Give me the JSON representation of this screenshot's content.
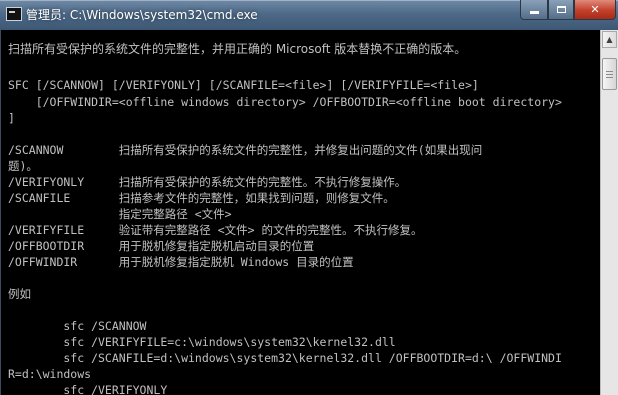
{
  "window": {
    "title": "管理员: C:\\Windows\\system32\\cmd.exe",
    "icon": "cmd-icon"
  },
  "controls": {
    "minimize": "minimize-icon",
    "maximize": "maximize-icon",
    "close_label": "✕"
  },
  "console": {
    "lines": [
      "扫描所有受保护的系统文件的完整性，并用正确的 Microsoft 版本替换不正确的版本。",
      "",
      "SFC [/SCANNOW] [/VERIFYONLY] [/SCANFILE=<file>] [/VERIFYFILE=<file>]",
      "    [/OFFWINDIR=<offline windows directory> /OFFBOOTDIR=<offline boot directory>",
      "]",
      "",
      "/SCANNOW        扫描所有受保护的系统文件的完整性，并修复出问题的文件(如果出现问",
      "题)。",
      "/VERIFYONLY     扫描所有受保护的系统文件的完整性。不执行修复操作。",
      "/SCANFILE       扫描参考文件的完整性，如果找到问题，则修复文件。",
      "                指定完整路径 <文件>",
      "/VERIFYFILE     验证带有完整路径 <文件> 的文件的完整性。不执行修复。",
      "/OFFBOOTDIR     用于脱机修复指定脱机启动目录的位置",
      "/OFFWINDIR      用于脱机修复指定脱机 Windows 目录的位置",
      "",
      "例如",
      "",
      "        sfc /SCANNOW",
      "        sfc /VERIFYFILE=c:\\windows\\system32\\kernel32.dll",
      "        sfc /SCANFILE=d:\\windows\\system32\\kernel32.dll /OFFBOOTDIR=d:\\ /OFFWINDI",
      "R=d:\\windows",
      "        sfc /VERIFYONLY"
    ]
  },
  "colors": {
    "console_bg": "#000000",
    "console_text": "#c0c0c0",
    "close_button": "#c2402b"
  }
}
